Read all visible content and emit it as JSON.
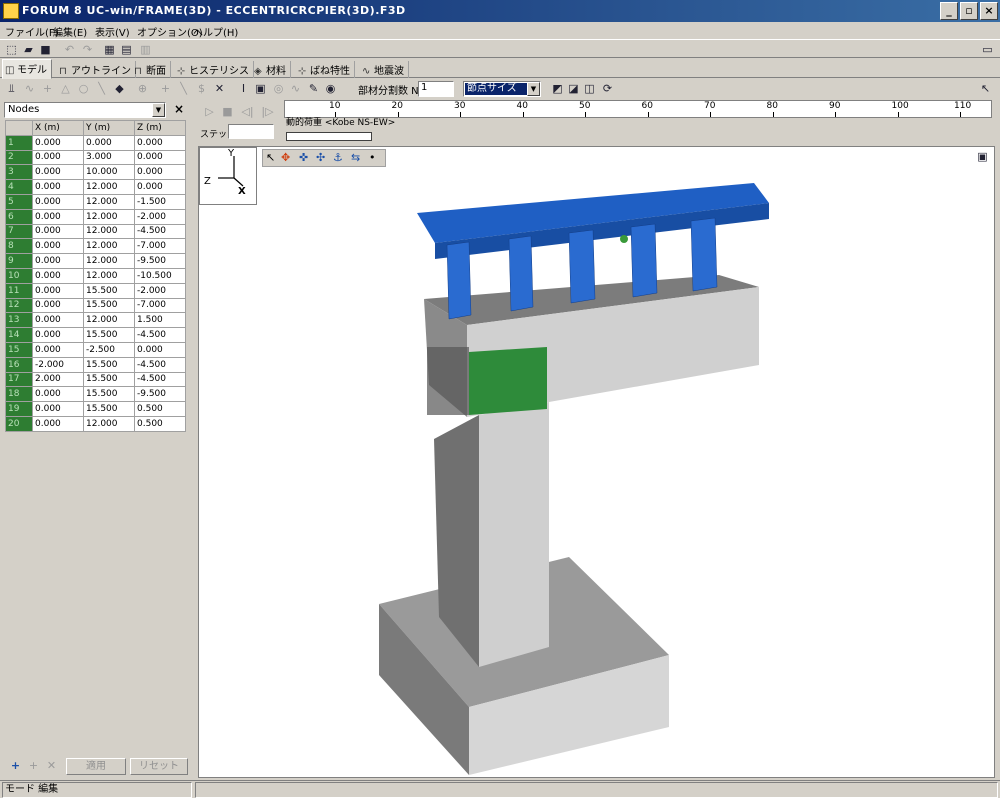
{
  "window": {
    "title": "FORUM 8  UC-win/FRAME(3D) - ECCENTRICRCPIER(3D).F3D",
    "minimize": "_",
    "maximize": "▫",
    "close": "×"
  },
  "menu": [
    "ファイル(F)",
    "編集(E)",
    "表示(V)",
    "オプション(O)",
    "ヘルプ(H)"
  ],
  "tabs": [
    "モデル",
    "アウトライン",
    "断面",
    "ヒステリシス",
    "材料",
    "ばね特性",
    "地震波"
  ],
  "toolbar2": {
    "divisions_label": "部材分割数 N",
    "divisions_value": "1",
    "node_size_value": "節点サイズ"
  },
  "nodes_panel": {
    "combo_value": "Nodes",
    "close": "×",
    "headers": [
      "",
      "X (m)",
      "Y (m)",
      "Z (m)"
    ],
    "rows": [
      [
        "1",
        "0.000",
        "0.000",
        "0.000"
      ],
      [
        "2",
        "0.000",
        "3.000",
        "0.000"
      ],
      [
        "3",
        "0.000",
        "10.000",
        "0.000"
      ],
      [
        "4",
        "0.000",
        "12.000",
        "0.000"
      ],
      [
        "5",
        "0.000",
        "12.000",
        "-1.500"
      ],
      [
        "6",
        "0.000",
        "12.000",
        "-2.000"
      ],
      [
        "7",
        "0.000",
        "12.000",
        "-4.500"
      ],
      [
        "8",
        "0.000",
        "12.000",
        "-7.000"
      ],
      [
        "9",
        "0.000",
        "12.000",
        "-9.500"
      ],
      [
        "10",
        "0.000",
        "12.000",
        "-10.500"
      ],
      [
        "11",
        "0.000",
        "15.500",
        "-2.000"
      ],
      [
        "12",
        "0.000",
        "15.500",
        "-7.000"
      ],
      [
        "13",
        "0.000",
        "12.000",
        "1.500"
      ],
      [
        "14",
        "0.000",
        "15.500",
        "-4.500"
      ],
      [
        "15",
        "0.000",
        "-2.500",
        "0.000"
      ],
      [
        "16",
        "-2.000",
        "15.500",
        "-4.500"
      ],
      [
        "17",
        "2.000",
        "15.500",
        "-4.500"
      ],
      [
        "18",
        "0.000",
        "15.500",
        "-9.500"
      ],
      [
        "19",
        "0.000",
        "15.500",
        "0.500"
      ],
      [
        "20",
        "0.000",
        "12.000",
        "0.500"
      ]
    ],
    "apply_label": "適用",
    "reset_label": "リセット"
  },
  "animation": {
    "ruler_ticks": [
      "10",
      "20",
      "30",
      "40",
      "50",
      "60",
      "70",
      "80",
      "90",
      "100",
      "110"
    ],
    "step_label": "ステップ°:",
    "load_label": "動的荷重 <Kobe NS-EW>"
  },
  "viewport": {
    "axis_y": "Y",
    "axis_z": "Z",
    "axis_x": "X"
  },
  "statusbar": {
    "mode": "モード 編集"
  },
  "colors": {
    "girder_blue": "#1f5fc4",
    "concrete": "#c8c8c8",
    "node_green": "#2e8b3a",
    "titlebar": "#0a246a"
  }
}
